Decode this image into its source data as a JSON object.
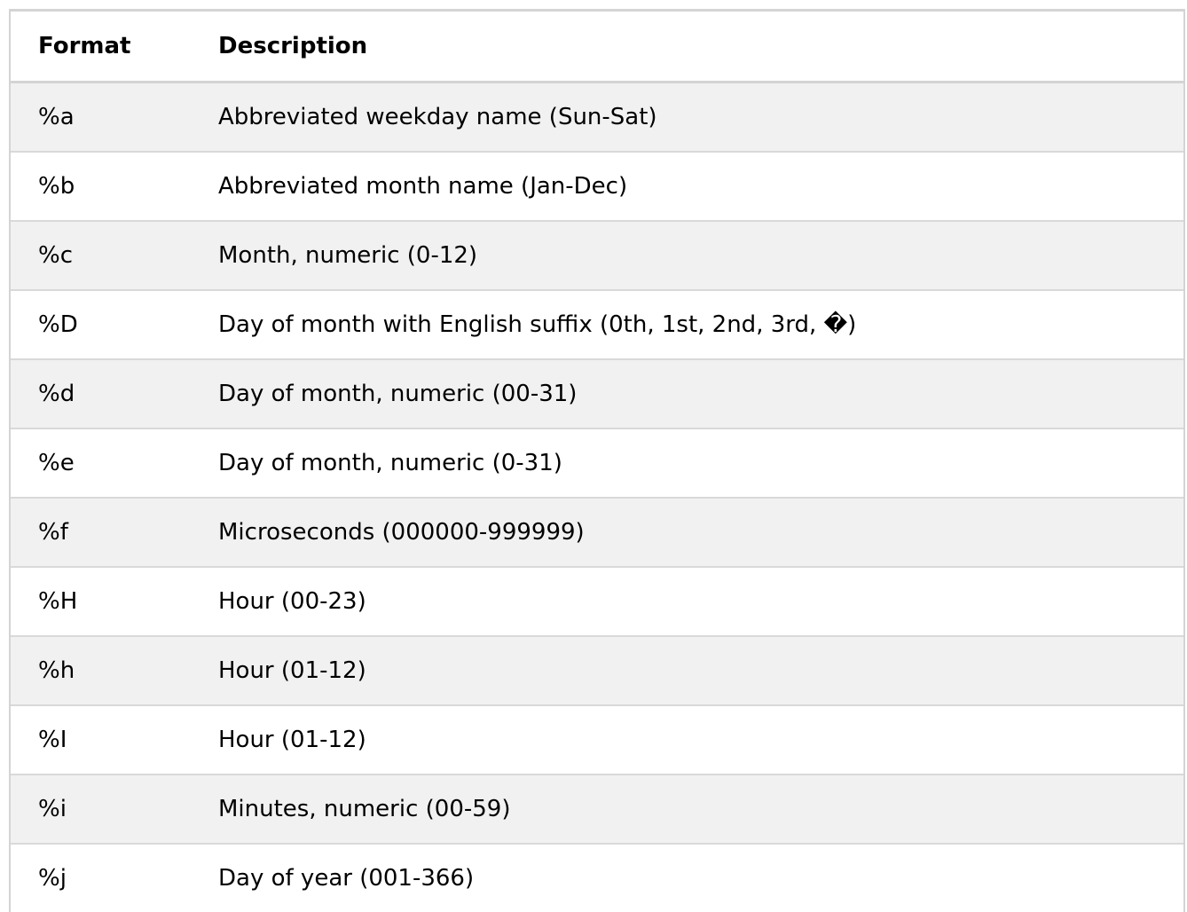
{
  "table": {
    "headers": [
      "Format",
      "Description"
    ],
    "rows": [
      [
        "%a",
        "Abbreviated weekday name (Sun-Sat)"
      ],
      [
        "%b",
        "Abbreviated month name (Jan-Dec)"
      ],
      [
        "%c",
        "Month, numeric (0-12)"
      ],
      [
        "%D",
        "Day of month with English suffix (0th, 1st, 2nd, 3rd, �)"
      ],
      [
        "%d",
        "Day of month, numeric (00-31)"
      ],
      [
        "%e",
        "Day of month, numeric (0-31)"
      ],
      [
        "%f",
        "Microseconds (000000-999999)"
      ],
      [
        "%H",
        "Hour (00-23)"
      ],
      [
        "%h",
        "Hour (01-12)"
      ],
      [
        "%I",
        "Hour (01-12)"
      ],
      [
        "%i",
        "Minutes, numeric (00-59)"
      ],
      [
        "%j",
        "Day of year (001-366)"
      ]
    ]
  },
  "colors": {
    "striped_row": "#f1f1f1",
    "plain_row": "#ffffff",
    "border": "#d4d4d4"
  }
}
